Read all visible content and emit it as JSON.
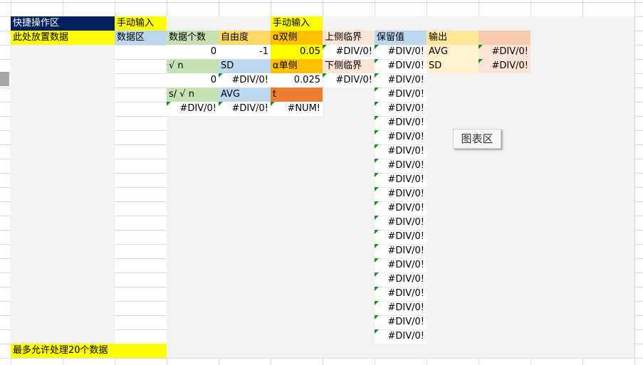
{
  "colors": {
    "navy": "#002060",
    "yellow": "#ffff00",
    "panel_gray": "#f2f2f2",
    "green": "#c6e0b4",
    "peach": "#fce4d6",
    "orange_light": "#ffd966",
    "blue": "#bdd7ee",
    "orange_gold": "#ffc000",
    "orange_dark": "#ed7d31",
    "cream": "#fff2cc",
    "salmon": "#f8cbad"
  },
  "quick_area": {
    "title": "快捷操作区",
    "subtitle": "此处放置数据"
  },
  "footer_note": "最多允许处理20个数据",
  "manual_input_1": "手动输入",
  "data_area_label": "数据区",
  "stats": {
    "count_label": "数据个数",
    "count_value": "0",
    "dof_label": "自由度",
    "dof_value": "-1",
    "sqrt_label": "√ n",
    "sqrt_value": "0",
    "sd_label": "SD",
    "sd_value": "#DIV/0!",
    "s_over_sqrt_label": "s/ √ n",
    "s_over_sqrt_value": "#DIV/0!",
    "avg_label": "AVG",
    "avg_value": "#DIV/0!"
  },
  "alpha": {
    "manual_input": "手动输入",
    "two_sided_label": "α双侧",
    "two_sided_value": "0.05",
    "one_sided_label": "α单侧",
    "one_sided_value": "0.025",
    "t_label": "t",
    "t_value": "#NUM!"
  },
  "critical": {
    "upper_label": "上侧临界",
    "upper_value": "#DIV/0!",
    "lower_label": "下侧临界",
    "lower_value": "#DIV/0!"
  },
  "retained": {
    "header": "保留值",
    "values": [
      "#DIV/0!",
      "#DIV/0!",
      "#DIV/0!",
      "#DIV/0!",
      "#DIV/0!",
      "#DIV/0!",
      "#DIV/0!",
      "#DIV/0!",
      "#DIV/0!",
      "#DIV/0!",
      "#DIV/0!",
      "#DIV/0!",
      "#DIV/0!",
      "#DIV/0!",
      "#DIV/0!",
      "#DIV/0!",
      "#DIV/0!",
      "#DIV/0!",
      "#DIV/0!",
      "#DIV/0!",
      "#DIV/0!"
    ]
  },
  "output": {
    "header": "输出",
    "avg_label": "AVG",
    "avg_value": "#DIV/0!",
    "sd_label": "SD",
    "sd_value": "#DIV/0!"
  },
  "chart_area_button": "图表区"
}
